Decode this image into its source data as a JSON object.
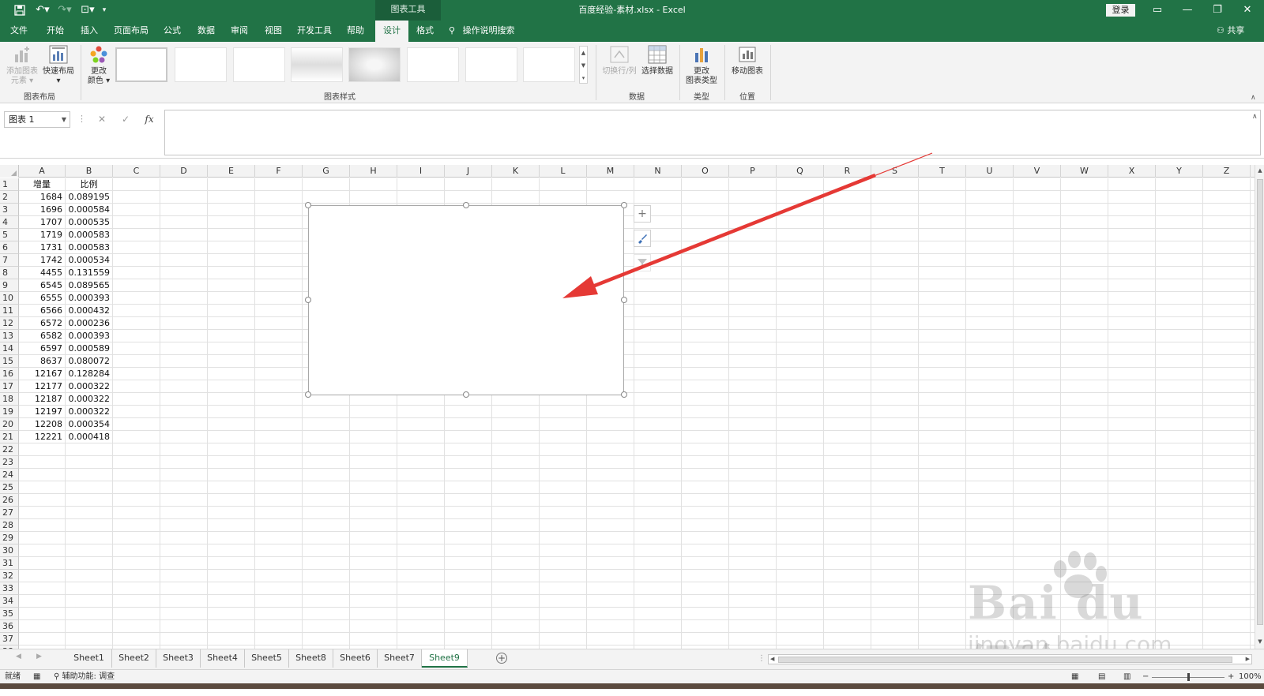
{
  "titlebar": {
    "quick_access": {
      "save_icon": "save-icon",
      "undo_icon": "undo-icon",
      "redo_icon": "redo-icon",
      "touch_icon": "touch-mode-icon",
      "customize_icon": "chevron-down-icon"
    },
    "context_tab_header": "图表工具",
    "document_title": "百度经验-素材.xlsx  -  Excel",
    "signin_label": "登录",
    "window_buttons": {
      "ribbon_display": "▭",
      "minimize": "—",
      "restore": "❐",
      "close": "✕"
    }
  },
  "tabs": [
    {
      "label": "文件"
    },
    {
      "label": "开始"
    },
    {
      "label": "插入"
    },
    {
      "label": "页面布局"
    },
    {
      "label": "公式"
    },
    {
      "label": "数据"
    },
    {
      "label": "审阅"
    },
    {
      "label": "视图"
    },
    {
      "label": "开发工具"
    },
    {
      "label": "帮助"
    },
    {
      "label": "设计",
      "active": true
    },
    {
      "label": "格式"
    }
  ],
  "tell_me": "操作说明搜索",
  "share_label": "共享",
  "ribbon": {
    "chart_layouts": {
      "add_element_line1": "添加图表",
      "add_element_line2": "元素",
      "quick_layout": "快速布局",
      "group_label": "图表布局"
    },
    "change_colors_line1": "更改",
    "change_colors_line2": "颜色",
    "chart_styles_label": "图表样式",
    "data": {
      "switch_row_col": "切换行/列",
      "select_data": "选择数据",
      "group_label": "数据"
    },
    "type": {
      "change_type_line1": "更改",
      "change_type_line2": "图表类型",
      "group_label": "类型"
    },
    "location": {
      "move_chart": "移动图表",
      "group_label": "位置"
    }
  },
  "formula_bar": {
    "name_box": "图表 1",
    "cancel": "✕",
    "enter": "✓",
    "fx": "fx",
    "value": ""
  },
  "columns": [
    "A",
    "B",
    "C",
    "D",
    "E",
    "F",
    "G",
    "H",
    "I",
    "J",
    "K",
    "L",
    "M",
    "N",
    "O",
    "P",
    "Q",
    "R",
    "S",
    "T",
    "U",
    "V",
    "W",
    "X",
    "Y",
    "Z"
  ],
  "rows_count": 38,
  "table": {
    "headers": [
      "增量",
      "比例"
    ],
    "rows": [
      [
        "1684",
        "0.089195"
      ],
      [
        "1696",
        "0.000584"
      ],
      [
        "1707",
        "0.000535"
      ],
      [
        "1719",
        "0.000583"
      ],
      [
        "1731",
        "0.000583"
      ],
      [
        "1742",
        "0.000534"
      ],
      [
        "4455",
        "0.131559"
      ],
      [
        "6545",
        "0.089565"
      ],
      [
        "6555",
        "0.000393"
      ],
      [
        "6566",
        "0.000432"
      ],
      [
        "6572",
        "0.000236"
      ],
      [
        "6582",
        "0.000393"
      ],
      [
        "6597",
        "0.000589"
      ],
      [
        "8637",
        "0.080072"
      ],
      [
        "12167",
        "0.128284"
      ],
      [
        "12177",
        "0.000322"
      ],
      [
        "12187",
        "0.000322"
      ],
      [
        "12197",
        "0.000322"
      ],
      [
        "12208",
        "0.000354"
      ],
      [
        "12221",
        "0.000418"
      ]
    ]
  },
  "chart_tools": {
    "elements": "+",
    "styles_icon": "brush-icon",
    "filter_icon": "filter-icon"
  },
  "sheets": [
    {
      "label": "Sheet1"
    },
    {
      "label": "Sheet2"
    },
    {
      "label": "Sheet3"
    },
    {
      "label": "Sheet4"
    },
    {
      "label": "Sheet5"
    },
    {
      "label": "Sheet8"
    },
    {
      "label": "Sheet6"
    },
    {
      "label": "Sheet7"
    },
    {
      "label": "Sheet9",
      "active": true
    }
  ],
  "status": {
    "ready": "就绪",
    "accessibility": "辅助功能: 调查",
    "zoom": "100%"
  },
  "colors": {
    "excel_green": "#217346",
    "annotation_red": "#e53935"
  },
  "watermark": {
    "main": "Bai du 经验",
    "sub": "jingyan.baidu.com"
  }
}
